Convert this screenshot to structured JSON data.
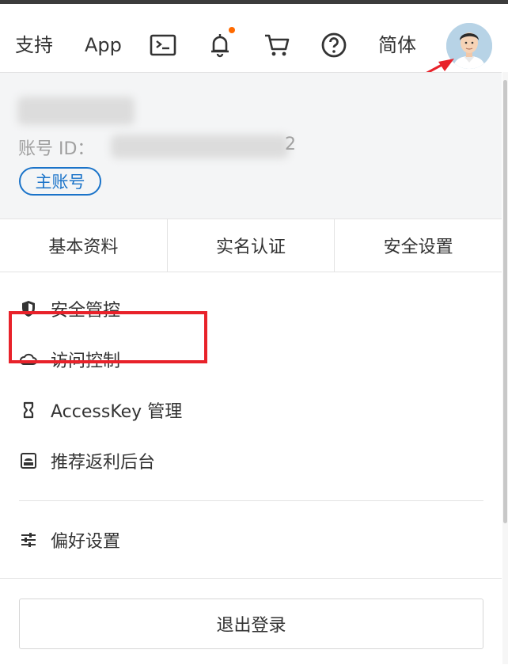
{
  "nav": {
    "support": "支持",
    "app": "App",
    "terminal_icon": "terminal-icon",
    "bell_icon": "bell-icon",
    "cart_icon": "cart-icon",
    "help_icon": "help-circle-icon",
    "language": "简体",
    "notification_dot_color": "#ff6a00"
  },
  "account": {
    "id_label": "账号 ID：",
    "id_tail": "2",
    "badge": "主账号"
  },
  "tabs": [
    {
      "label": "基本资料"
    },
    {
      "label": "实名认证"
    },
    {
      "label": "安全设置"
    }
  ],
  "menu": [
    {
      "label": "安全管控",
      "icon": "shield-icon"
    },
    {
      "label": "访问控制",
      "icon": "cloud-icon"
    },
    {
      "label": "AccessKey 管理",
      "icon": "key-bracket-icon"
    },
    {
      "label": "推荐返利后台",
      "icon": "rebate-icon"
    }
  ],
  "preferences": {
    "label": "偏好设置",
    "icon": "sliders-icon"
  },
  "logout": {
    "label": "退出登录"
  },
  "colors": {
    "accent_blue": "#1a73c9",
    "highlight_red": "#e8222a",
    "annotation_arrow": "#e8222a"
  }
}
